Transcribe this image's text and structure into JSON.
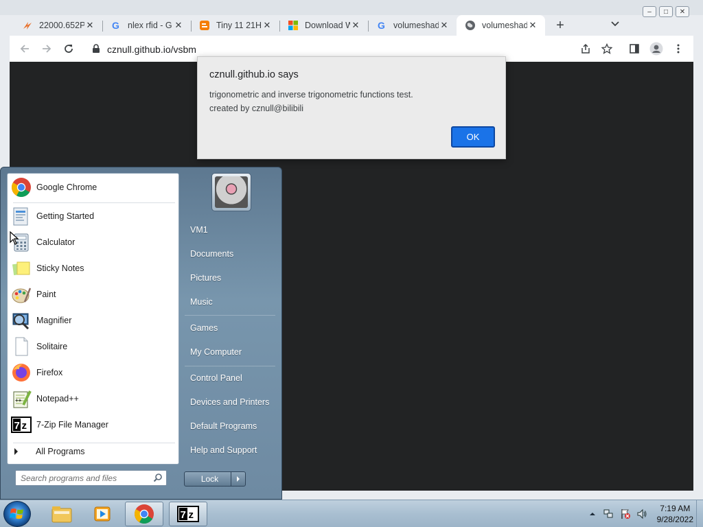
{
  "browser": {
    "window_title": "Google Chrome",
    "tabs": [
      {
        "title": "22000.652P",
        "favicon": "lightning-icon"
      },
      {
        "title": "nlex rfid - G",
        "favicon": "google-icon"
      },
      {
        "title": "Tiny 11 21H",
        "favicon": "blogger-icon"
      },
      {
        "title": "Download W",
        "favicon": "microsoft-icon"
      },
      {
        "title": "volumeshad",
        "favicon": "google-icon"
      },
      {
        "title": "volumeshad",
        "favicon": "globe-icon"
      }
    ],
    "active_tab": 5,
    "url": "cznull.github.io/vsbm"
  },
  "alert": {
    "title": "cznull.github.io says",
    "line1": "trigonometric and inverse trigonometric functions test.",
    "line2": "created by cznull@bilibili",
    "ok": "OK"
  },
  "start_menu": {
    "programs": [
      {
        "label": "Google Chrome",
        "icon": "chrome-icon"
      },
      {
        "label": "Getting Started",
        "icon": "getting-started-icon"
      },
      {
        "label": "Calculator",
        "icon": "calculator-icon"
      },
      {
        "label": "Sticky Notes",
        "icon": "sticky-notes-icon"
      },
      {
        "label": "Paint",
        "icon": "paint-icon"
      },
      {
        "label": "Magnifier",
        "icon": "magnifier-icon"
      },
      {
        "label": "Solitaire",
        "icon": "solitaire-icon"
      },
      {
        "label": "Firefox",
        "icon": "firefox-icon"
      },
      {
        "label": "Notepad++",
        "icon": "notepad-plus-plus-icon"
      },
      {
        "label": "7-Zip File Manager",
        "icon": "seven-zip-icon"
      }
    ],
    "all_programs": "All Programs",
    "search_placeholder": "Search programs and files",
    "right_items": [
      "VM1",
      "Documents",
      "Pictures",
      "Music",
      "Games",
      "My Computer",
      "Control Panel",
      "Devices and Printers",
      "Default Programs",
      "Help and Support"
    ],
    "lock": "Lock"
  },
  "taskbar": {
    "time": "7:19 AM",
    "date": "9/28/2022",
    "pinned": [
      "windows-explorer-icon",
      "media-player-icon",
      "chrome-icon",
      "seven-zip-icon"
    ]
  }
}
